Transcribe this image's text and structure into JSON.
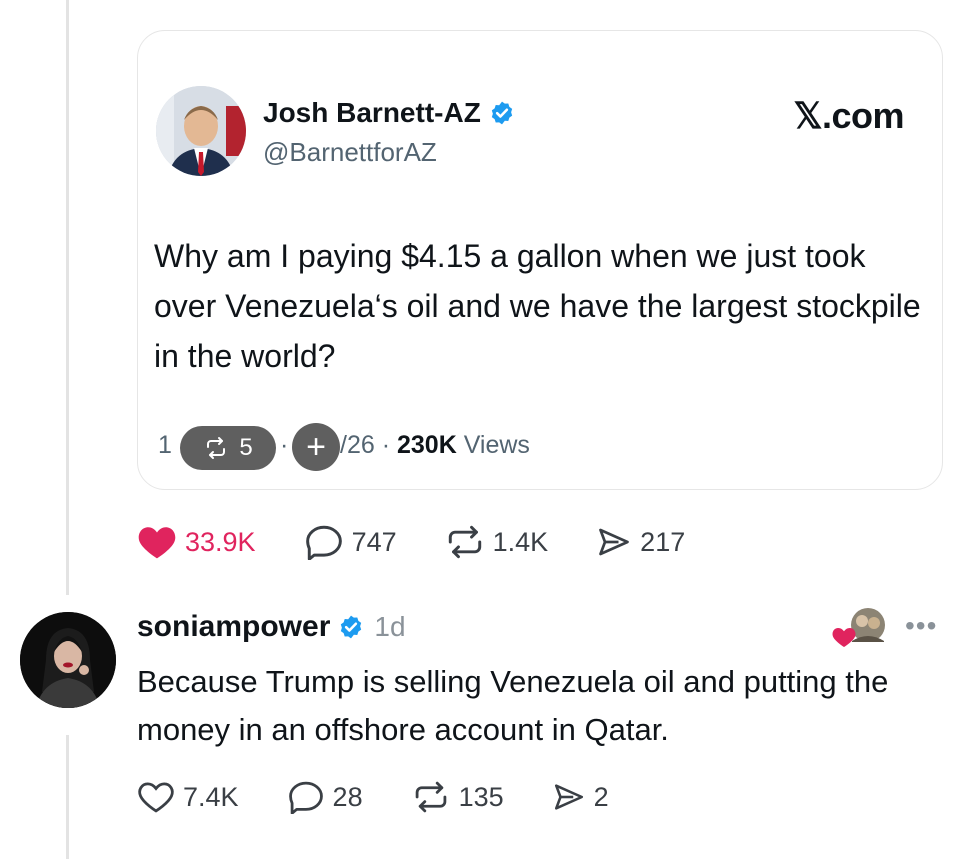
{
  "quoted_post": {
    "author_name": "Josh Barnett-AZ",
    "handle": "@BarnettforAZ",
    "site_label": "𝕏.com",
    "text": "Why am I paying $4.15 a gallon when we just took over Venezuela‘s oil and we have the largest stockpile in the world?",
    "meta": {
      "repost_count": "5",
      "date_fragment_left": "1",
      "date_fragment_right": "/26 · ",
      "views_count": "230K",
      "views_label": " Views"
    }
  },
  "main_actions": {
    "likes": "33.9K",
    "replies": "747",
    "reposts": "1.4K",
    "shares": "217"
  },
  "reply": {
    "username": "soniampower",
    "time": "1d",
    "more_label": "•••",
    "text": "Because Trump is selling Venezuela oil and putting the money in an offshore account in Qatar.",
    "actions": {
      "likes": "7.4K",
      "replies": "28",
      "reposts": "135",
      "shares": "2"
    }
  },
  "colors": {
    "like_red": "#e0245e",
    "verified_blue": "#1d9bf0",
    "secondary_text": "#536471",
    "pill_gray": "#5f5f5f"
  },
  "icons": [
    "verified-badge-icon",
    "repost-icon",
    "plus-icon",
    "heart-icon",
    "reply-icon",
    "share-icon",
    "more-icon"
  ]
}
